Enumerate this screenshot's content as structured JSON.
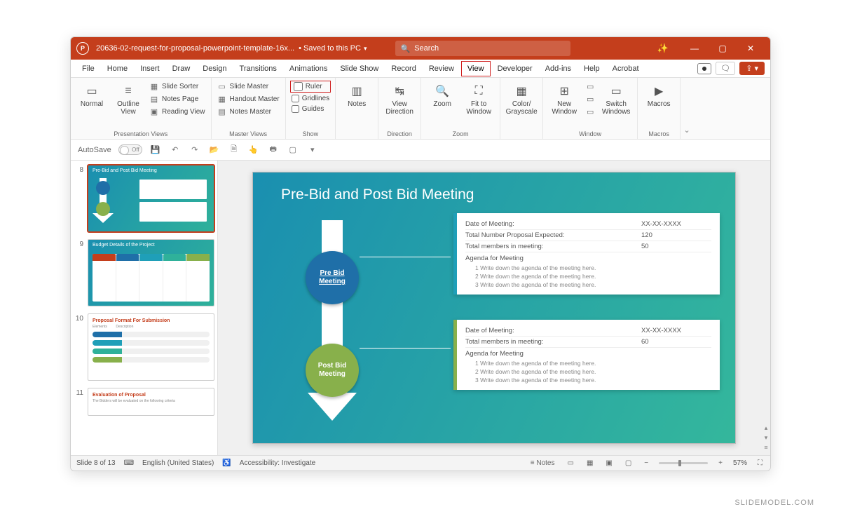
{
  "titlebar": {
    "filename": "20636-02-request-for-proposal-powerpoint-template-16x...",
    "saved": "Saved to this PC",
    "search_placeholder": "Search"
  },
  "menu": {
    "file": "File",
    "home": "Home",
    "insert": "Insert",
    "draw": "Draw",
    "design": "Design",
    "transitions": "Transitions",
    "animations": "Animations",
    "slideshow": "Slide Show",
    "record": "Record",
    "review": "Review",
    "view": "View",
    "developer": "Developer",
    "addins": "Add-ins",
    "help": "Help",
    "acrobat": "Acrobat"
  },
  "ribbon": {
    "normal": "Normal",
    "outline_view": "Outline View",
    "slide_sorter": "Slide Sorter",
    "notes_page": "Notes Page",
    "reading_view": "Reading View",
    "presentation_views": "Presentation Views",
    "slide_master": "Slide Master",
    "handout_master": "Handout Master",
    "notes_master": "Notes Master",
    "master_views": "Master Views",
    "ruler": "Ruler",
    "gridlines": "Gridlines",
    "guides": "Guides",
    "show": "Show",
    "notes": "Notes",
    "view_direction": "View Direction",
    "direction": "Direction",
    "zoom": "Zoom",
    "fit_window": "Fit to Window",
    "zoom_group": "Zoom",
    "color_gray": "Color/\nGrayscale",
    "new_window": "New Window",
    "switch_windows": "Switch Windows",
    "window": "Window",
    "macros": "Macros",
    "macros_group": "Macros"
  },
  "qat": {
    "autosave": "AutoSave",
    "off": "Off"
  },
  "thumbs": {
    "n8": "8",
    "t8": "Pre-Bid and Post Bid Meeting",
    "n9": "9",
    "t9": "Budget Details of the Project",
    "n10": "10",
    "t10": "Proposal Format For Submission",
    "n11": "11",
    "t11": "Evaluation of Proposal"
  },
  "slide": {
    "title": "Pre-Bid and Post Bid Meeting",
    "prebid": "Pre Bid Meeting",
    "postbid": "Post Bid Meeting",
    "box1": {
      "r1l": "Date of Meeting:",
      "r1v": "XX-XX-XXXX",
      "r2l": "Total Number Proposal Expected:",
      "r2v": "120",
      "r3l": "Total members in meeting:",
      "r3v": "50",
      "agenda": "Agenda for Meeting",
      "a1": "1  Write down the agenda of the meeting here.",
      "a2": "2  Write down the agenda of the meeting here.",
      "a3": "3  Write down the agenda of the meeting here."
    },
    "box2": {
      "r1l": "Date of Meeting:",
      "r1v": "XX-XX-XXXX",
      "r2l": "Total members in meeting:",
      "r2v": "60",
      "agenda": "Agenda for Meeting",
      "a1": "1  Write down the agenda of the meeting here.",
      "a2": "2  Write down the agenda of the meeting here.",
      "a3": "3  Write down the agenda of the meeting here."
    }
  },
  "status": {
    "slide": "Slide 8 of 13",
    "lang": "English (United States)",
    "access": "Accessibility: Investigate",
    "notes": "Notes",
    "zoom": "57%"
  },
  "watermark": "SLIDEMODEL.COM"
}
